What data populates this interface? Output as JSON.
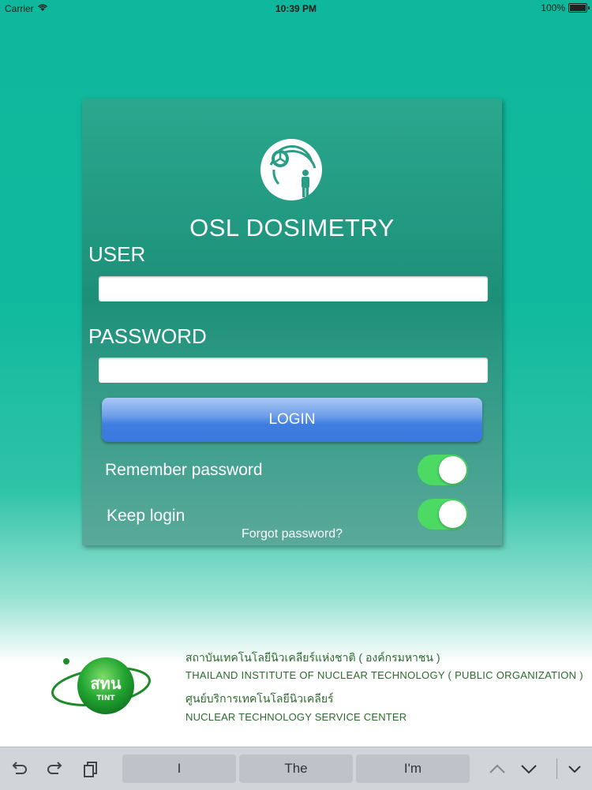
{
  "status_bar": {
    "carrier": "Carrier",
    "time": "10:39 PM",
    "battery": "100%"
  },
  "login": {
    "title": "OSL DOSIMETRY",
    "user_label": "USER",
    "user_value": "",
    "password_label": "PASSWORD",
    "password_value": "",
    "login_button": "LOGIN",
    "remember_label": "Remember password",
    "remember_on": true,
    "keep_label": "Keep login",
    "keep_on": true,
    "forgot": "Forgot password?"
  },
  "footer": {
    "org_name_th": "สถาบันเทคโนโลยีนิวเคลียร์แห่งชาติ ( องค์กรมหาชน )",
    "org_name_en": "THAILAND INSTITUTE OF NUCLEAR TECHNOLOGY ( PUBLIC ORGANIZATION )",
    "center_th": "ศูนย์บริการเทคโนโลยีนิวเคลียร์",
    "center_en": "NUCLEAR TECHNOLOGY SERVICE CENTER",
    "logo_text": "สทน",
    "logo_subtext": "TINT"
  },
  "keyboard_bar": {
    "suggestions": [
      "I",
      "The",
      "I'm"
    ]
  },
  "colors": {
    "background_top": "#10b99d",
    "card": "#1d8f79",
    "login_button": "#3f7ee0",
    "toggle_on": "#4cd964",
    "org_green": "#2d6a2d"
  }
}
